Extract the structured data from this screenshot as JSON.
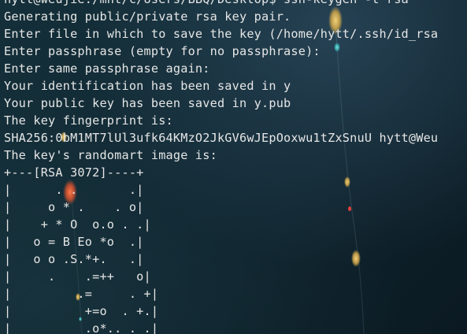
{
  "terminal": {
    "lines": [
      "hytt@weujie:/mnt/c/Users/BBQ/Desktop$ ssh-keygen -t rsa",
      "Generating public/private rsa key pair.",
      "Enter file in which to save the key (/home/hytt/.ssh/id_rsa",
      "Enter passphrase (empty for no passphrase):",
      "Enter same passphrase again:",
      "Your identification has been saved in y",
      "Your public key has been saved in y.pub",
      "The key fingerprint is:",
      "SHA256:0bM1MT7lUl3ufk64KMzO2JkGV6wJEpOoxwu1tZxSnuU hytt@Weu",
      "The key's randomart image is:",
      "+---[RSA 3072]----+",
      "|      . .       .|",
      "|     o * .    . o|",
      "|    + * O  o.o . .|",
      "|   o = B Eo *o  .|",
      "|   o o .S.*+.   .|",
      "|     .    .=++   o|",
      "|         .=     . +|",
      "|          +=o  . +.|",
      "|          .o*.. . .|"
    ]
  },
  "colors": {
    "text": "#e6e6e6",
    "background": "#0f2530",
    "accent_dots": [
      "#c9a24a",
      "#d8532f",
      "#e0413a",
      "#3cb6b8"
    ]
  }
}
